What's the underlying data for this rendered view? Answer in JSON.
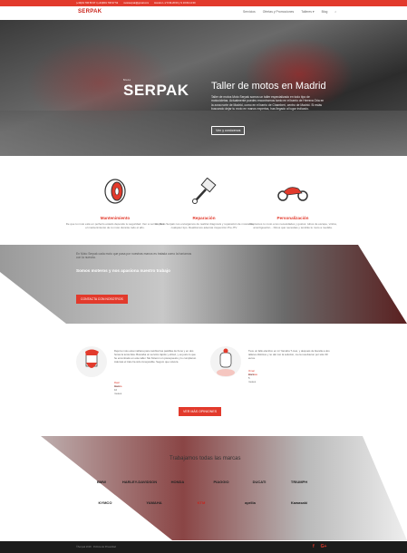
{
  "topbar": {
    "phone": "(+34)91 706 56 97 / (+34)691 706 97 52",
    "email": "motoserpak@gmail.com",
    "hours": "Horario L-V 9:30-20:00 y S 10:00-14:00"
  },
  "header": {
    "logo": "SERPAK",
    "nav": [
      "Servicios",
      "Ofertas y Promociones",
      "Talleres ▾",
      "Blog"
    ],
    "search_icon": "search-icon"
  },
  "hero": {
    "logo_small": "Moto",
    "logo": "SERPAK",
    "title": "Taller de motos en Madrid",
    "text": "Taller de motos Moto Serpak somos un taller especializado en todo tipo de motocicletas. Actualmente puedes encontrarnos tanto en el barrio de Herrera Oria en la zona norte de Madrid, como en el barrio de Chamberí, centro de Madrid. Si estás buscando dejar tu moto en manos expertas, has llegado al lugar indicado.",
    "button": "Ven y conócenos"
  },
  "features": [
    {
      "icon": "tire-icon",
      "title": "Mantenimiento",
      "text": "De que tu moto esté en perfecto estado depende tu seguridad. Ven a vernos para el mantenimiento de tu moto durante todo el año."
    },
    {
      "icon": "piston-icon",
      "title": "Reparación",
      "text": "En Moto Serpak nos encargamos de realizar diagnosis y reparación de motos de cualquier tipo. Realizamos además inspección Pre-ITV"
    },
    {
      "icon": "motorcycle-icon",
      "title": "Personalización",
      "text": "Adaptamos tu moto a tus necesidades y gustos: tubos de escape, vinilos, amortiguación... Dinos qué necesitas y tendrás tu moto a medida."
    }
  ],
  "band": {
    "text": "En Moto Serpak cada moto que pasa por nuestras manos es tratada como la haríamos con la nuestra.",
    "heading": "Somos moteros y nos apasiona nuestro trabajo",
    "button": "CONTACTA CON NOSOTROS"
  },
  "testimonials": [
    {
      "text": "Dejé la moto esta mañana para cambiar las pastillas de freno y en dos horas la tenía lista. Buscaba un servicio rápido y eficaz, y es justo lo que he encontrado en este taller. Me hicieron un presupuesto y lo cumplieron. Además el trato ha sido inmejorable. Seguro que volveré.",
      "name": "Raúl García",
      "time": "Hace 10 meses"
    },
    {
      "text": "Tuve un fallo eléctrico en mi Yamaha T-max, y después de llevarla a dos talleres distintos y no dar con la solución, me la resolvieron por sólo 30 euros.",
      "name": "Omar Encinas",
      "time": "Hace 5 meses"
    }
  ],
  "more_button": "VER MÁS OPINIONES",
  "brands": {
    "title": "Trabajamos todas las marcas",
    "items": [
      "BMW",
      "HARLEY-DAVIDSON",
      "HONDA",
      "PIAGGIO",
      "DUCATI",
      "TRIUMPH",
      "KYMCO",
      "YAMAHA",
      "KTM",
      "aprilia",
      "Kawasaki"
    ]
  },
  "footer": {
    "copy": "©Serpak 2018 · Política de Privacidad",
    "social": [
      "f",
      "G+"
    ]
  },
  "colors": {
    "accent": "#e23a2c",
    "footer": "#1c1c1c"
  }
}
